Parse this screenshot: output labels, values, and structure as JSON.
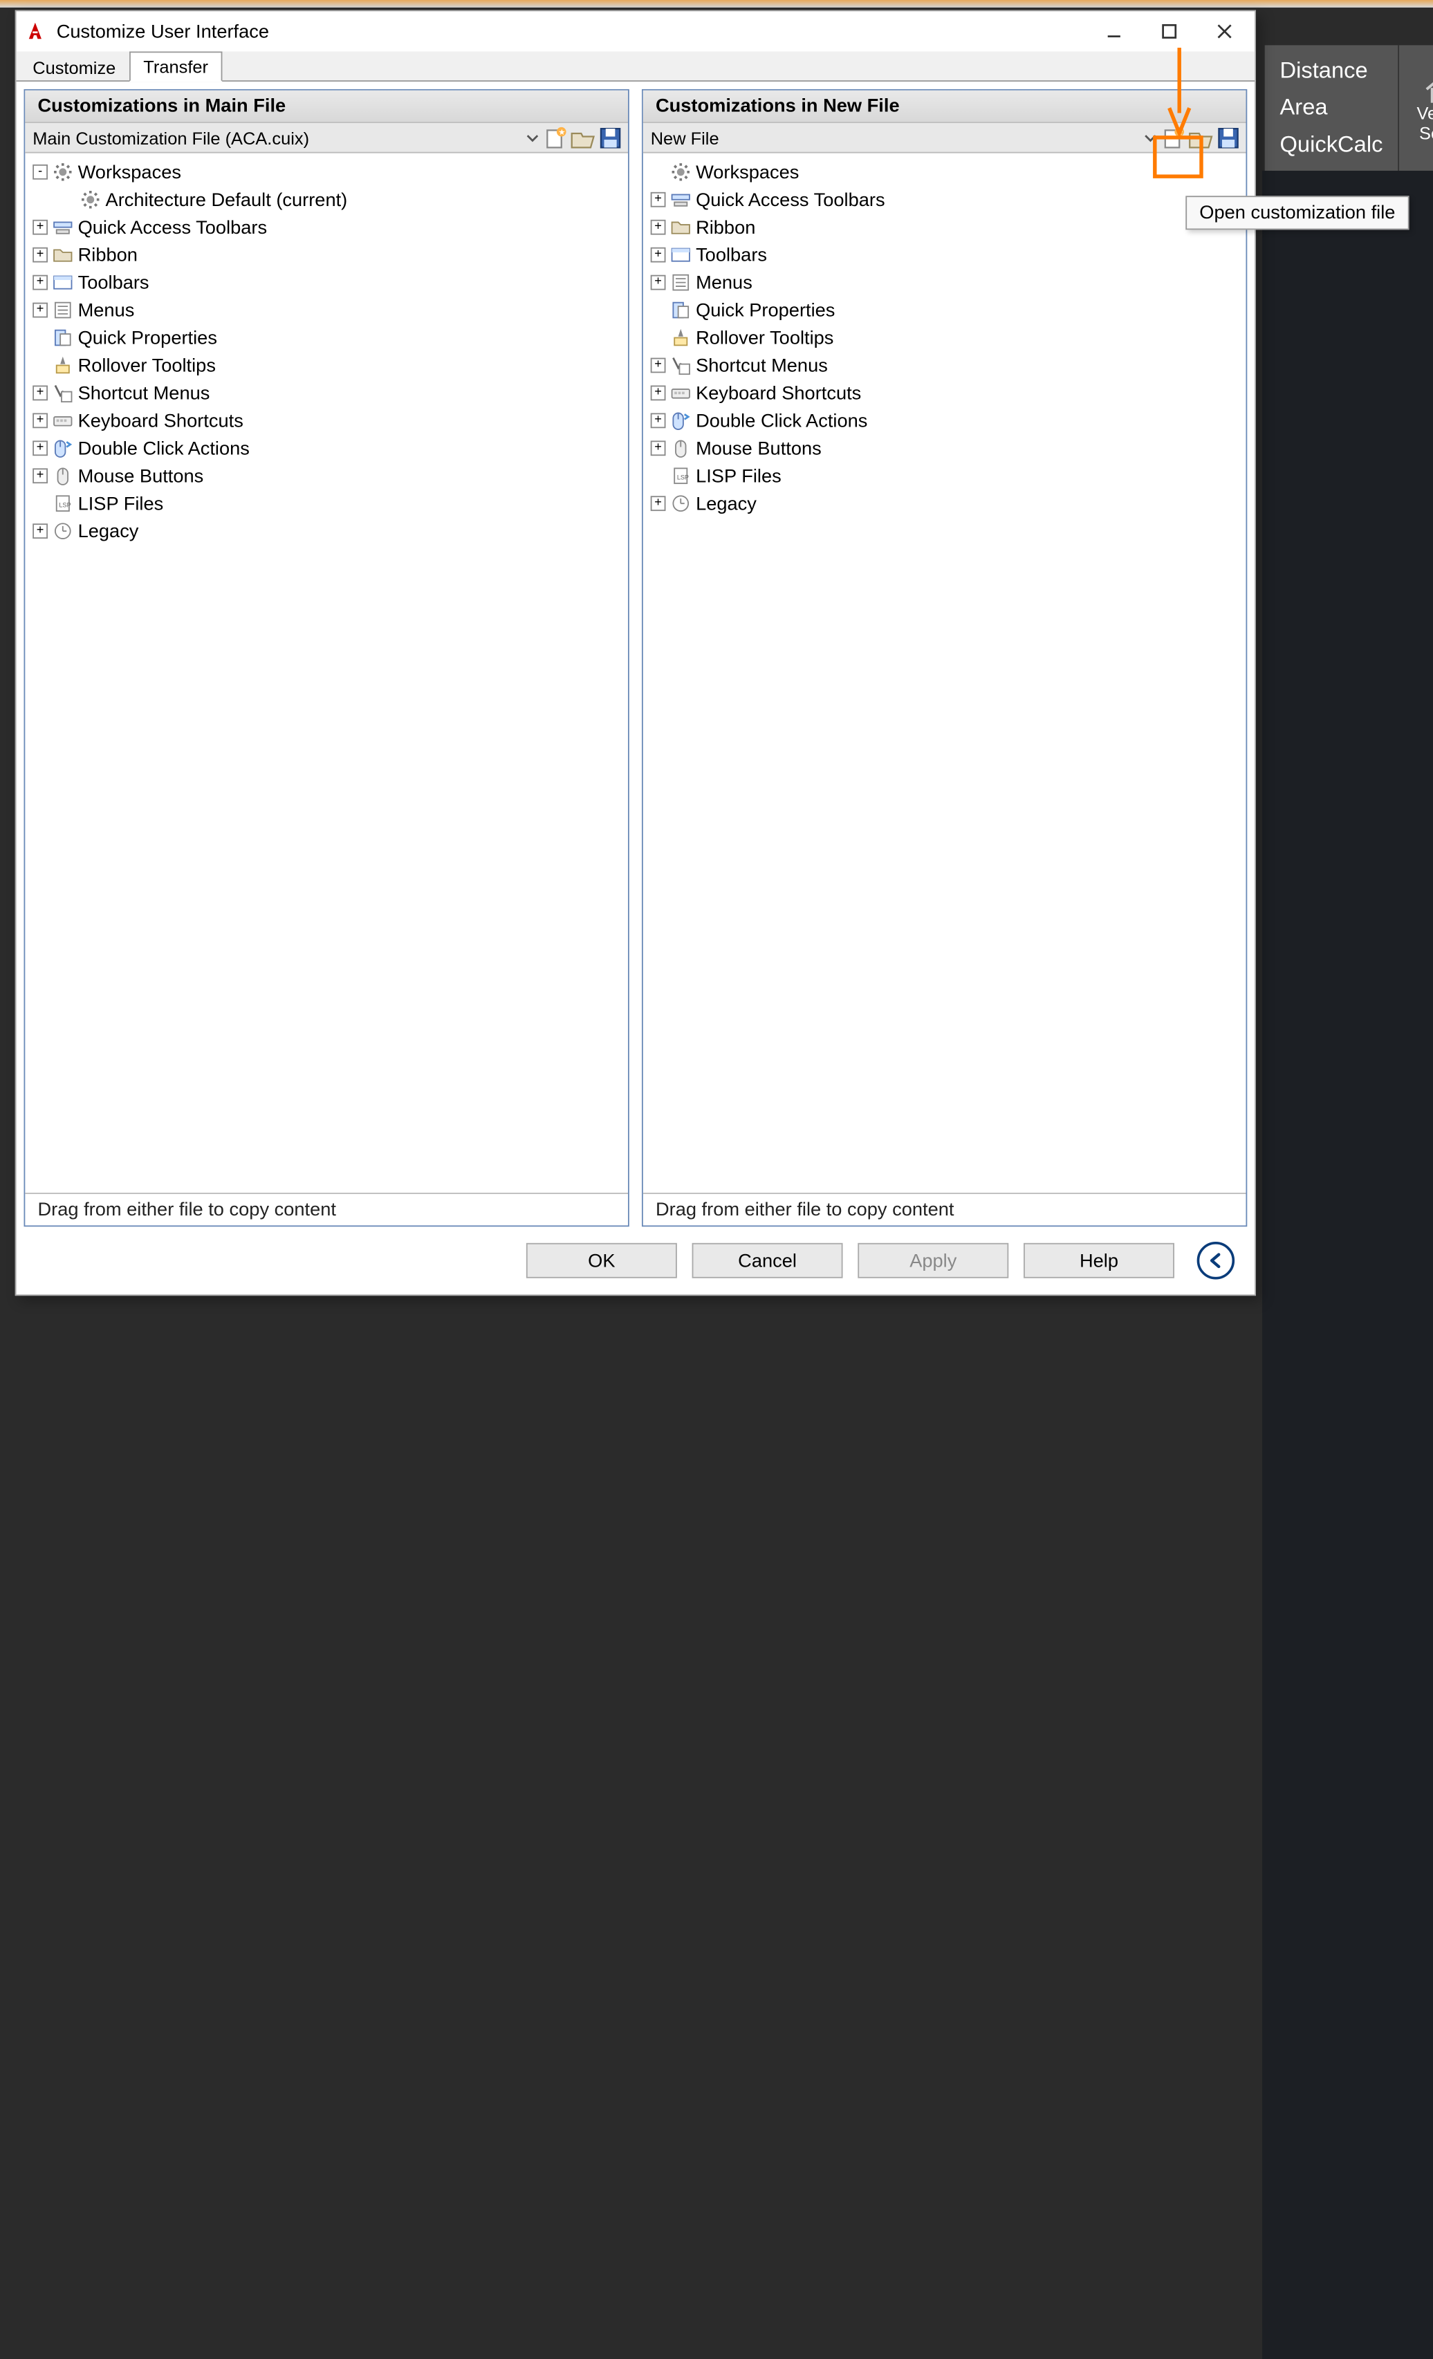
{
  "window": {
    "title": "Customize User Interface",
    "tabs": {
      "customize": "Customize",
      "transfer": "Transfer"
    }
  },
  "left": {
    "header": "Customizations in Main File",
    "combo": "Main Customization File (ACA.cuix)",
    "footer": "Drag from either file to copy content",
    "tree": [
      {
        "d": 0,
        "exp": "-",
        "icon": "gear",
        "label": "Workspaces"
      },
      {
        "d": 1,
        "exp": " ",
        "icon": "gear",
        "label": "Architecture Default (current)"
      },
      {
        "d": 0,
        "exp": "+",
        "icon": "qat",
        "label": "Quick Access Toolbars"
      },
      {
        "d": 0,
        "exp": "+",
        "icon": "folder",
        "label": "Ribbon"
      },
      {
        "d": 0,
        "exp": "+",
        "icon": "toolbar",
        "label": "Toolbars"
      },
      {
        "d": 0,
        "exp": "+",
        "icon": "menu",
        "label": "Menus"
      },
      {
        "d": 0,
        "exp": " ",
        "icon": "qprop",
        "label": "Quick Properties"
      },
      {
        "d": 0,
        "exp": " ",
        "icon": "rtip",
        "label": "Rollover Tooltips"
      },
      {
        "d": 0,
        "exp": "+",
        "icon": "scut",
        "label": "Shortcut Menus"
      },
      {
        "d": 0,
        "exp": "+",
        "icon": "kbd",
        "label": "Keyboard Shortcuts"
      },
      {
        "d": 0,
        "exp": "+",
        "icon": "dclick",
        "label": "Double Click Actions"
      },
      {
        "d": 0,
        "exp": "+",
        "icon": "mouse",
        "label": "Mouse Buttons"
      },
      {
        "d": 0,
        "exp": " ",
        "icon": "lisp",
        "label": "LISP Files"
      },
      {
        "d": 0,
        "exp": "+",
        "icon": "legacy",
        "label": "Legacy"
      }
    ]
  },
  "right": {
    "header": "Customizations in New File",
    "combo": "New File",
    "footer": "Drag from either file to copy content",
    "tree": [
      {
        "d": 0,
        "exp": " ",
        "icon": "gear",
        "label": "Workspaces"
      },
      {
        "d": 0,
        "exp": "+",
        "icon": "qat",
        "label": "Quick Access Toolbars"
      },
      {
        "d": 0,
        "exp": "+",
        "icon": "folder",
        "label": "Ribbon"
      },
      {
        "d": 0,
        "exp": "+",
        "icon": "toolbar",
        "label": "Toolbars"
      },
      {
        "d": 0,
        "exp": "+",
        "icon": "menu",
        "label": "Menus"
      },
      {
        "d": 0,
        "exp": " ",
        "icon": "qprop",
        "label": "Quick Properties"
      },
      {
        "d": 0,
        "exp": " ",
        "icon": "rtip",
        "label": "Rollover Tooltips"
      },
      {
        "d": 0,
        "exp": "+",
        "icon": "scut",
        "label": "Shortcut Menus"
      },
      {
        "d": 0,
        "exp": "+",
        "icon": "kbd",
        "label": "Keyboard Shortcuts"
      },
      {
        "d": 0,
        "exp": "+",
        "icon": "dclick",
        "label": "Double Click Actions"
      },
      {
        "d": 0,
        "exp": "+",
        "icon": "mouse",
        "label": "Mouse Buttons"
      },
      {
        "d": 0,
        "exp": " ",
        "icon": "lisp",
        "label": "LISP Files"
      },
      {
        "d": 0,
        "exp": "+",
        "icon": "legacy",
        "label": "Legacy"
      }
    ]
  },
  "buttons": {
    "ok": "OK",
    "cancel": "Cancel",
    "apply": "Apply",
    "help": "Help"
  },
  "tooltip": "Open customization file",
  "bg": {
    "distance": "Distance",
    "area": "Area",
    "quickcalc": "QuickCalc",
    "vertical": "Vertica",
    "section": "Sectio"
  },
  "tool_names": {
    "new": "new-file-icon",
    "open": "open-file-icon",
    "save": "save-file-icon"
  }
}
